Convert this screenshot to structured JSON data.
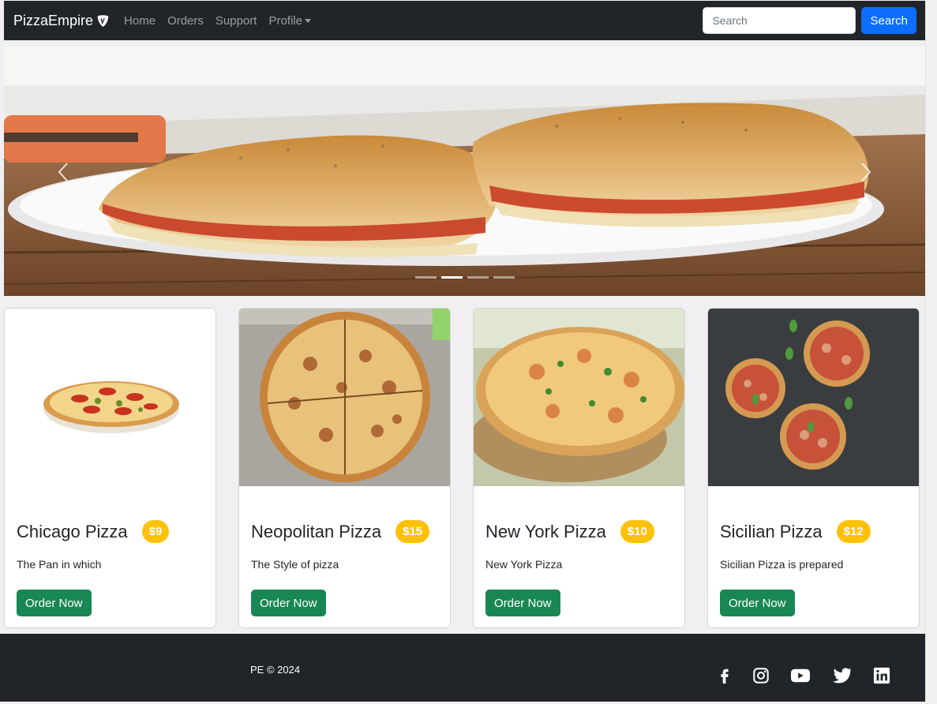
{
  "navbar": {
    "brand": "PizzaEmpire",
    "links": [
      "Home",
      "Orders",
      "Support",
      "Profile"
    ],
    "search_placeholder": "Search",
    "search_button": "Search"
  },
  "carousel": {
    "slide_count": 4,
    "active_index": 1
  },
  "cards": [
    {
      "title": "Chicago Pizza",
      "price": "$9",
      "text": "The Pan in which",
      "button": "Order Now"
    },
    {
      "title": "Neopolitan Pizza",
      "price": "$15",
      "text": "The Style of pizza",
      "button": "Order Now"
    },
    {
      "title": "New York Pizza",
      "price": "$10",
      "text": "New York Pizza",
      "button": "Order Now"
    },
    {
      "title": "Sicilian Pizza",
      "price": "$12",
      "text": "Sicilian Pizza is prepared",
      "button": "Order Now"
    }
  ],
  "footer": {
    "copyright": "PE © 2024",
    "social_icons": [
      "facebook-icon",
      "instagram-icon",
      "youtube-icon",
      "twitter-icon",
      "linkedin-icon"
    ]
  },
  "colors": {
    "navbar_bg": "#212529",
    "primary": "#0d6efd",
    "success": "#198754",
    "warning": "#ffc107"
  }
}
